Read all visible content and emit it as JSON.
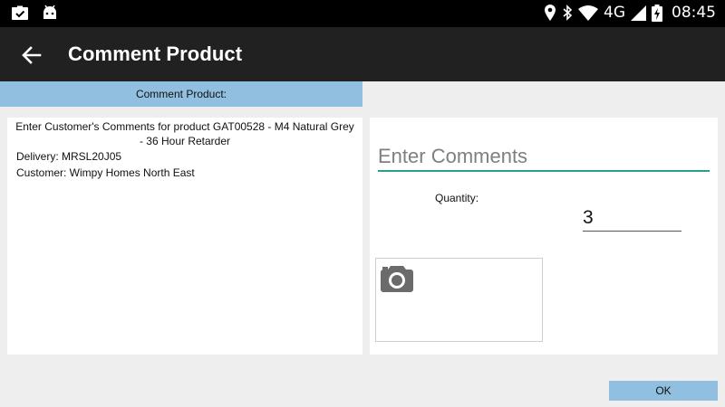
{
  "status_bar": {
    "time": "08:45",
    "network": "4G",
    "icons": [
      "briefcase-check-icon",
      "android-icon",
      "location-icon",
      "bluetooth-icon",
      "wifi-icon",
      "signal-icon",
      "battery-charging-icon"
    ]
  },
  "app_bar": {
    "title": "Comment Product",
    "back_icon": "arrow-back-icon"
  },
  "section_header": "Comment Product:",
  "product_info": {
    "description": "Enter Customer's Comments for product GAT00528 - M4 Natural Grey - 36 Hour Retarder",
    "delivery": "Delivery: MRSL20J05",
    "customer": "Customer: Wimpy Homes North East"
  },
  "form": {
    "comments_placeholder": "Enter Comments",
    "comments_value": "",
    "quantity_label": "Quantity:",
    "quantity_value": "3",
    "photo_icon": "camera-icon"
  },
  "actions": {
    "ok_label": "OK"
  },
  "colors": {
    "status_bar": "#000000",
    "app_bar": "#212121",
    "accent": "#2a9d8f",
    "button": "#90bfe0"
  }
}
